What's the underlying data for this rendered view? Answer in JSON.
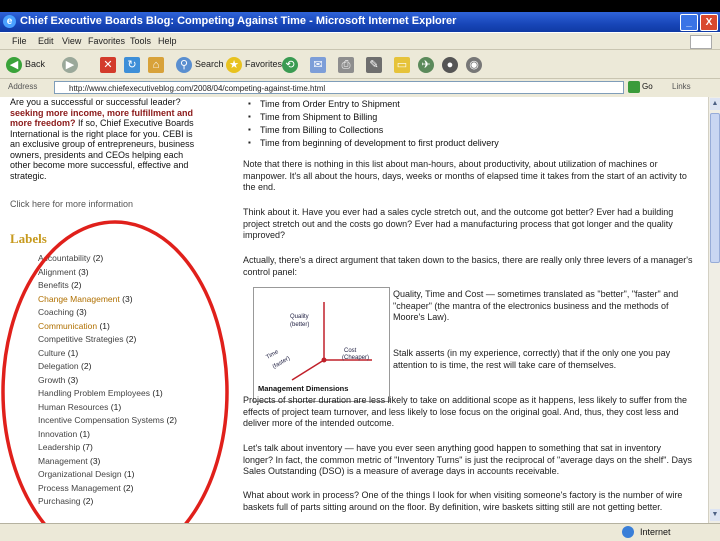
{
  "window": {
    "title": "Chief Executive Boards Blog: Competing Against Time - Microsoft Internet Explorer",
    "buttons": [
      "_",
      "□",
      "X"
    ]
  },
  "menu": [
    "File",
    "Edit",
    "View",
    "Favorites",
    "Tools",
    "Help"
  ],
  "toolbar": {
    "back": "Back",
    "search": "Search",
    "favorites": "Favorites"
  },
  "address": {
    "label": "Address",
    "url": "http://www.chiefexecutiveblog.com/2008/04/competing-against-time.html",
    "go": "Go",
    "links": "Links"
  },
  "sidebar": {
    "intro_prefix": "Are you a successful or successful leader?",
    "intro_highlight": "seeking more income, more fulfillment and more freedom?",
    "intro_rest": "If so, Chief Executive Boards International is the right place for you. CEBI is an exclusive group of entrepreneurs, business owners, presidents and CEOs helping each other become more successful, effective and strategic.",
    "click_line": "Click here for more information",
    "labels_heading": "Labels",
    "labels": [
      {
        "text": "Accountability",
        "count": "(2)"
      },
      {
        "text": "Alignment",
        "count": "(3)"
      },
      {
        "text": "Benefits",
        "count": "(2)"
      },
      {
        "text": "Change Management",
        "count": "(3)"
      },
      {
        "text": "Coaching",
        "count": "(3)"
      },
      {
        "text": "Communication",
        "count": "(1)"
      },
      {
        "text": "Competitive Strategies",
        "count": "(2)"
      },
      {
        "text": "Culture",
        "count": "(1)"
      },
      {
        "text": "Delegation",
        "count": "(2)"
      },
      {
        "text": "Growth",
        "count": "(3)"
      },
      {
        "text": "Handling Problem Employees",
        "count": "(1)"
      },
      {
        "text": "Human Resources",
        "count": "(1)"
      },
      {
        "text": "Incentive Compensation Systems",
        "count": "(2)"
      },
      {
        "text": "Innovation",
        "count": "(1)"
      },
      {
        "text": "Leadership",
        "count": "(7)"
      },
      {
        "text": "Management",
        "count": "(3)"
      },
      {
        "text": "Organizational Design",
        "count": "(1)"
      },
      {
        "text": "Process Management",
        "count": "(2)"
      },
      {
        "text": "Purchasing",
        "count": "(2)"
      }
    ]
  },
  "main": {
    "bullets": [
      "Time from Order Entry to Shipment",
      "Time from Shipment to Billing",
      "Time from Billing to Collections",
      "Time from beginning of development to first product delivery"
    ],
    "para1": "Note that there is nothing in this list about man-hours, about productivity, about utilization of machines or manpower. It's all about the hours, days, weeks or months of elapsed time it takes from the start of an activity to the end.",
    "para2": "Think about it. Have you ever had a sales cycle stretch out, and the outcome got better? Ever had a building project stretch out and the costs go down? Ever had a manufacturing process that got longer and the quality improved?",
    "para3": "Actually, there's a direct argument that taken down to the basics, there are really only three levers of a manager's control panel:",
    "para4": "Quality, Time and Cost — sometimes translated as \"better\", \"faster\" and \"cheaper\" (the mantra of the electronics business and the methods of Moore's Law).",
    "para5": "Stalk asserts (in my experience, correctly) that if the only one you pay attention to is time, the rest will take care of themselves.",
    "para6": "Projects of shorter duration are less likely to take on additional scope as it happens, less likely to suffer from the effects of project team turnover, and less likely to lose focus on the original goal. And, thus, they cost less and deliver more of the intended outcome.",
    "para7": "Let's talk about inventory — have you ever seen anything good happen to something that sat in inventory longer? In fact, the common metric of \"Inventory Turns\" is just the reciprocal of \"average days on the shelf\". Days Sales Outstanding (DSO) is a measure of average days in accounts receivable.",
    "para8": "What about work in process? One of the things I look for when visiting someone's factory is the number of wire baskets full of parts sitting around on the floor. By definition, wire baskets sitting still are not getting better.",
    "diagram": {
      "quality": "Quality",
      "better": "(better)",
      "time": "Time",
      "faster": "(faster)",
      "cost": "Cost",
      "cheaper": "(Cheaper)",
      "caption": "Management Dimensions"
    }
  },
  "status": {
    "zone": "Internet"
  }
}
